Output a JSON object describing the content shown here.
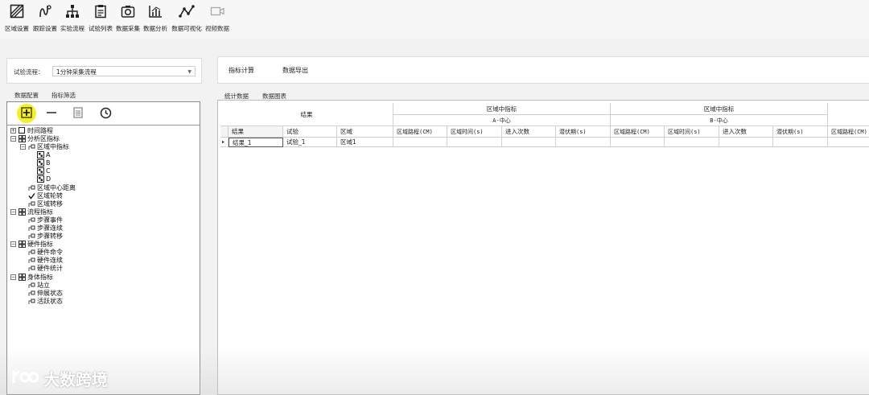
{
  "toolbar": {
    "items": [
      {
        "label": "区域设置",
        "icon": "area-grid-icon",
        "enabled": true
      },
      {
        "label": "跟踪设置",
        "icon": "track-icon",
        "enabled": true
      },
      {
        "label": "实验流程",
        "icon": "flow-tree-icon",
        "enabled": true
      },
      {
        "label": "试验列表",
        "icon": "clipboard-list-icon",
        "enabled": true
      },
      {
        "label": "数据采集",
        "icon": "camera-icon",
        "enabled": true
      },
      {
        "label": "数据分析",
        "icon": "bar-chart-icon",
        "enabled": true
      },
      {
        "label": "数据可视化",
        "icon": "line-graph-icon",
        "enabled": true
      },
      {
        "label": "视频数据",
        "icon": "video-icon",
        "enabled": false
      }
    ]
  },
  "flow": {
    "label": "试验流程：",
    "selected": "1分钟采集流程"
  },
  "left_tabs": [
    "数据配置",
    "指标筛选"
  ],
  "tree_toolbar": {
    "buttons": [
      {
        "icon": "add-icon",
        "highlight": true
      },
      {
        "icon": "minus-icon",
        "highlight": false
      },
      {
        "icon": "document-icon",
        "highlight": false
      },
      {
        "icon": "clock-icon",
        "highlight": false
      }
    ]
  },
  "tree": [
    {
      "label": "时间路程",
      "level": 0,
      "expander": "+",
      "icon": "checkbox-icon"
    },
    {
      "label": "分析区指标",
      "level": 0,
      "expander": "-",
      "icon": "grid-icon"
    },
    {
      "label": "区域中指标",
      "level": 1,
      "expander": "-",
      "icon": "leaf-icon"
    },
    {
      "label": "A",
      "level": 2,
      "expander": "",
      "icon": "region-icon"
    },
    {
      "label": "B",
      "level": 2,
      "expander": "",
      "icon": "region-icon"
    },
    {
      "label": "C",
      "level": 2,
      "expander": "",
      "icon": "region-icon"
    },
    {
      "label": "D",
      "level": 2,
      "expander": "",
      "icon": "region-icon"
    },
    {
      "label": "区域中心距离",
      "level": 1,
      "expander": "",
      "icon": "leaf-icon"
    },
    {
      "label": "区域轮转",
      "level": 1,
      "expander": "",
      "icon": "check-icon"
    },
    {
      "label": "区域转移",
      "level": 1,
      "expander": "",
      "icon": "leaf-icon"
    },
    {
      "label": "流程指标",
      "level": 0,
      "expander": "-",
      "icon": "grid-icon"
    },
    {
      "label": "步骤事件",
      "level": 1,
      "expander": "",
      "icon": "leaf-icon"
    },
    {
      "label": "步骤连续",
      "level": 1,
      "expander": "",
      "icon": "leaf-icon"
    },
    {
      "label": "步骤转移",
      "level": 1,
      "expander": "",
      "icon": "leaf-icon"
    },
    {
      "label": "硬件指标",
      "level": 0,
      "expander": "-",
      "icon": "grid-icon"
    },
    {
      "label": "硬件命令",
      "level": 1,
      "expander": "",
      "icon": "leaf-icon"
    },
    {
      "label": "硬件连续",
      "level": 1,
      "expander": "",
      "icon": "leaf-icon"
    },
    {
      "label": "硬件统计",
      "level": 1,
      "expander": "",
      "icon": "leaf-icon"
    },
    {
      "label": "身体指标",
      "level": 0,
      "expander": "-",
      "icon": "grid-icon"
    },
    {
      "label": "站立",
      "level": 1,
      "expander": "",
      "icon": "leaf-icon"
    },
    {
      "label": "伸展状态",
      "level": 1,
      "expander": "",
      "icon": "leaf-icon"
    },
    {
      "label": "活跃状态",
      "level": 1,
      "expander": "",
      "icon": "leaf-icon"
    }
  ],
  "right_tabs": [
    "指标计算",
    "数据导出"
  ],
  "stat_tabs": [
    "统计数据",
    "数据图表"
  ],
  "table": {
    "results_header": "结果",
    "group_header_1": "区域中指标",
    "group_sub_1": "A-中心",
    "group_header_2": "区域中指标",
    "group_sub_2": "B-中心",
    "columns": [
      "结果",
      "试验",
      "区域",
      "区域路程(CM)",
      "区域时间(s)",
      "进入次数",
      "潜伏期(s)",
      "区域路程(CM)",
      "区域时间(s)",
      "进入次数",
      "潜伏期(s)",
      "区域路程(CM)"
    ],
    "rows": [
      [
        "结果_1",
        "试验_1",
        "区域1",
        "",
        "",
        "",
        "",
        "",
        "",
        "",
        "",
        ""
      ]
    ]
  },
  "watermark": "大数跨境"
}
